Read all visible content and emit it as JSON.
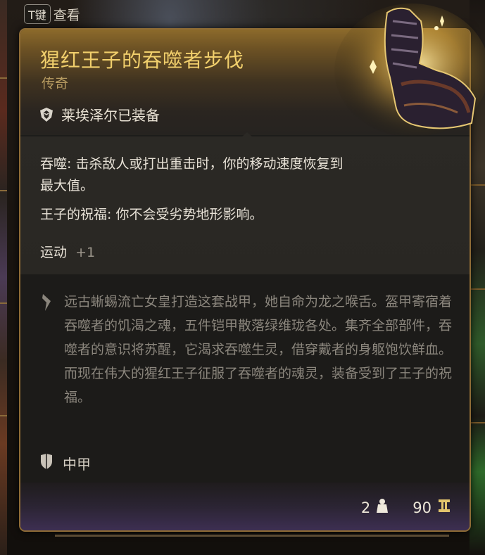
{
  "hint": {
    "key": "T键",
    "label": "查看"
  },
  "item": {
    "name": "猩红王子的吞噬者步伐",
    "rarity": "传奇",
    "equipped_by": "莱埃泽尔已装备",
    "effects": [
      {
        "name": "吞噬:",
        "text": " 击杀敌人或打出重击时，你的移动速度恢复到最大值。"
      },
      {
        "name": "王子的祝福:",
        "text": " 你不会受劣势地形影响。"
      }
    ],
    "stat": {
      "label": "运动",
      "bonus": "+1"
    },
    "lore": "远古蜥蜴流亡女皇打造这套战甲，她自命为龙之喉舌。盔甲寄宿着吞噬者的饥渴之魂，五件铠甲散落绿维珑各处。集齐全部部件，吞噬者的意识将苏醒，它渴求吞噬生灵，借穿戴者的身躯饱饮鲜血。而现在伟大的猩红王子征服了吞噬者的魂灵，装备受到了王子的祝福。",
    "armor_type": "中甲",
    "weight": "2",
    "value": "90"
  },
  "colors": {
    "title_gold": "#f1cf6c",
    "rarity": "#b89c61",
    "border": "#8f6c36",
    "lore_text": "#8b867d"
  },
  "icons": [
    "keyboard-key",
    "character-portrait-icon",
    "quill-icon",
    "shield-icon",
    "weight-icon",
    "gold-coin-icon",
    "boot-armor-icon"
  ]
}
